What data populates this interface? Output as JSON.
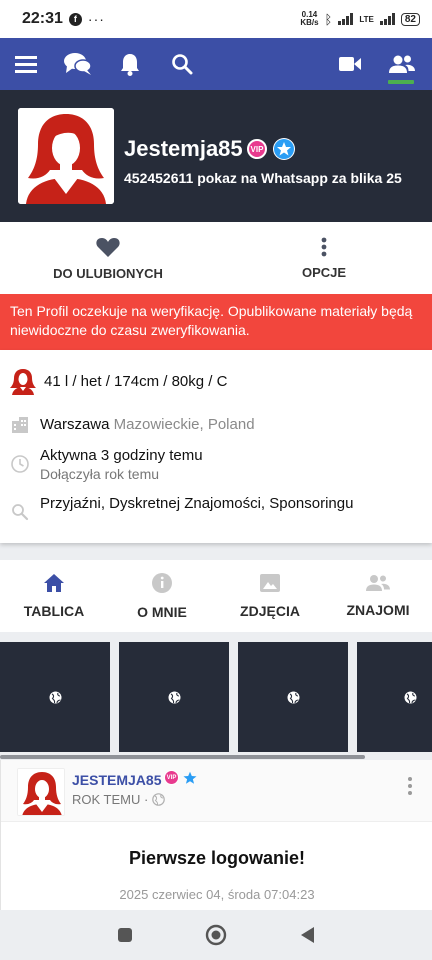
{
  "status_bar": {
    "time": "22:31",
    "dots": "···",
    "speed_value": "0.14",
    "speed_unit": "KB/s",
    "network": "LTE",
    "battery": "82"
  },
  "app_bar": {
    "icons": [
      "menu-icon",
      "chat-icon",
      "bell-icon",
      "search-icon",
      "video-icon",
      "friends-icon"
    ],
    "accent_color": "#3c4fa6",
    "active_indicator_color": "#4caf50"
  },
  "profile": {
    "username": "Jestemja85",
    "vip_badge": "VIP",
    "subtitle": "452452611 pokaz na Whatsapp za blika 25"
  },
  "actions": {
    "favorite_label": "DO ULUBIONYCH",
    "options_label": "OPCJE"
  },
  "warning": {
    "text": "Ten Profil oczekuje na weryfikację. Opublikowane materiały będą niewidoczne do czasu zweryfikowania.",
    "color": "#f2463d"
  },
  "info": {
    "stats": "41 l / het / 174cm / 80kg / C",
    "city": "Warszawa",
    "region": "Mazowieckie, Poland",
    "active": "Aktywna 3 godziny temu",
    "joined": "Dołączyła rok temu",
    "looking_for": "Przyjaźni, Dyskretnej Znajomości, Sponsoringu"
  },
  "tabs": [
    {
      "label": "TABLICA",
      "icon": "home-icon",
      "active": true
    },
    {
      "label": "O MNIE",
      "icon": "info-icon",
      "active": false
    },
    {
      "label": "ZDJĘCIA",
      "icon": "image-icon",
      "active": false
    },
    {
      "label": "ZNAJOMI",
      "icon": "friends-icon",
      "active": false
    }
  ],
  "gallery": {
    "tile_count": 4,
    "tile_icon": "globe-icon"
  },
  "post": {
    "author": "JESTEMJA85",
    "vip_badge": "VIP",
    "time": "ROK TEMU ·",
    "title": "Pierwsze logowanie!",
    "date": "2025 czerwiec 04, środa 07:04:23"
  },
  "nav_bar": {
    "icons": [
      "recents-square-icon",
      "home-circle-icon",
      "back-triangle-icon"
    ]
  }
}
